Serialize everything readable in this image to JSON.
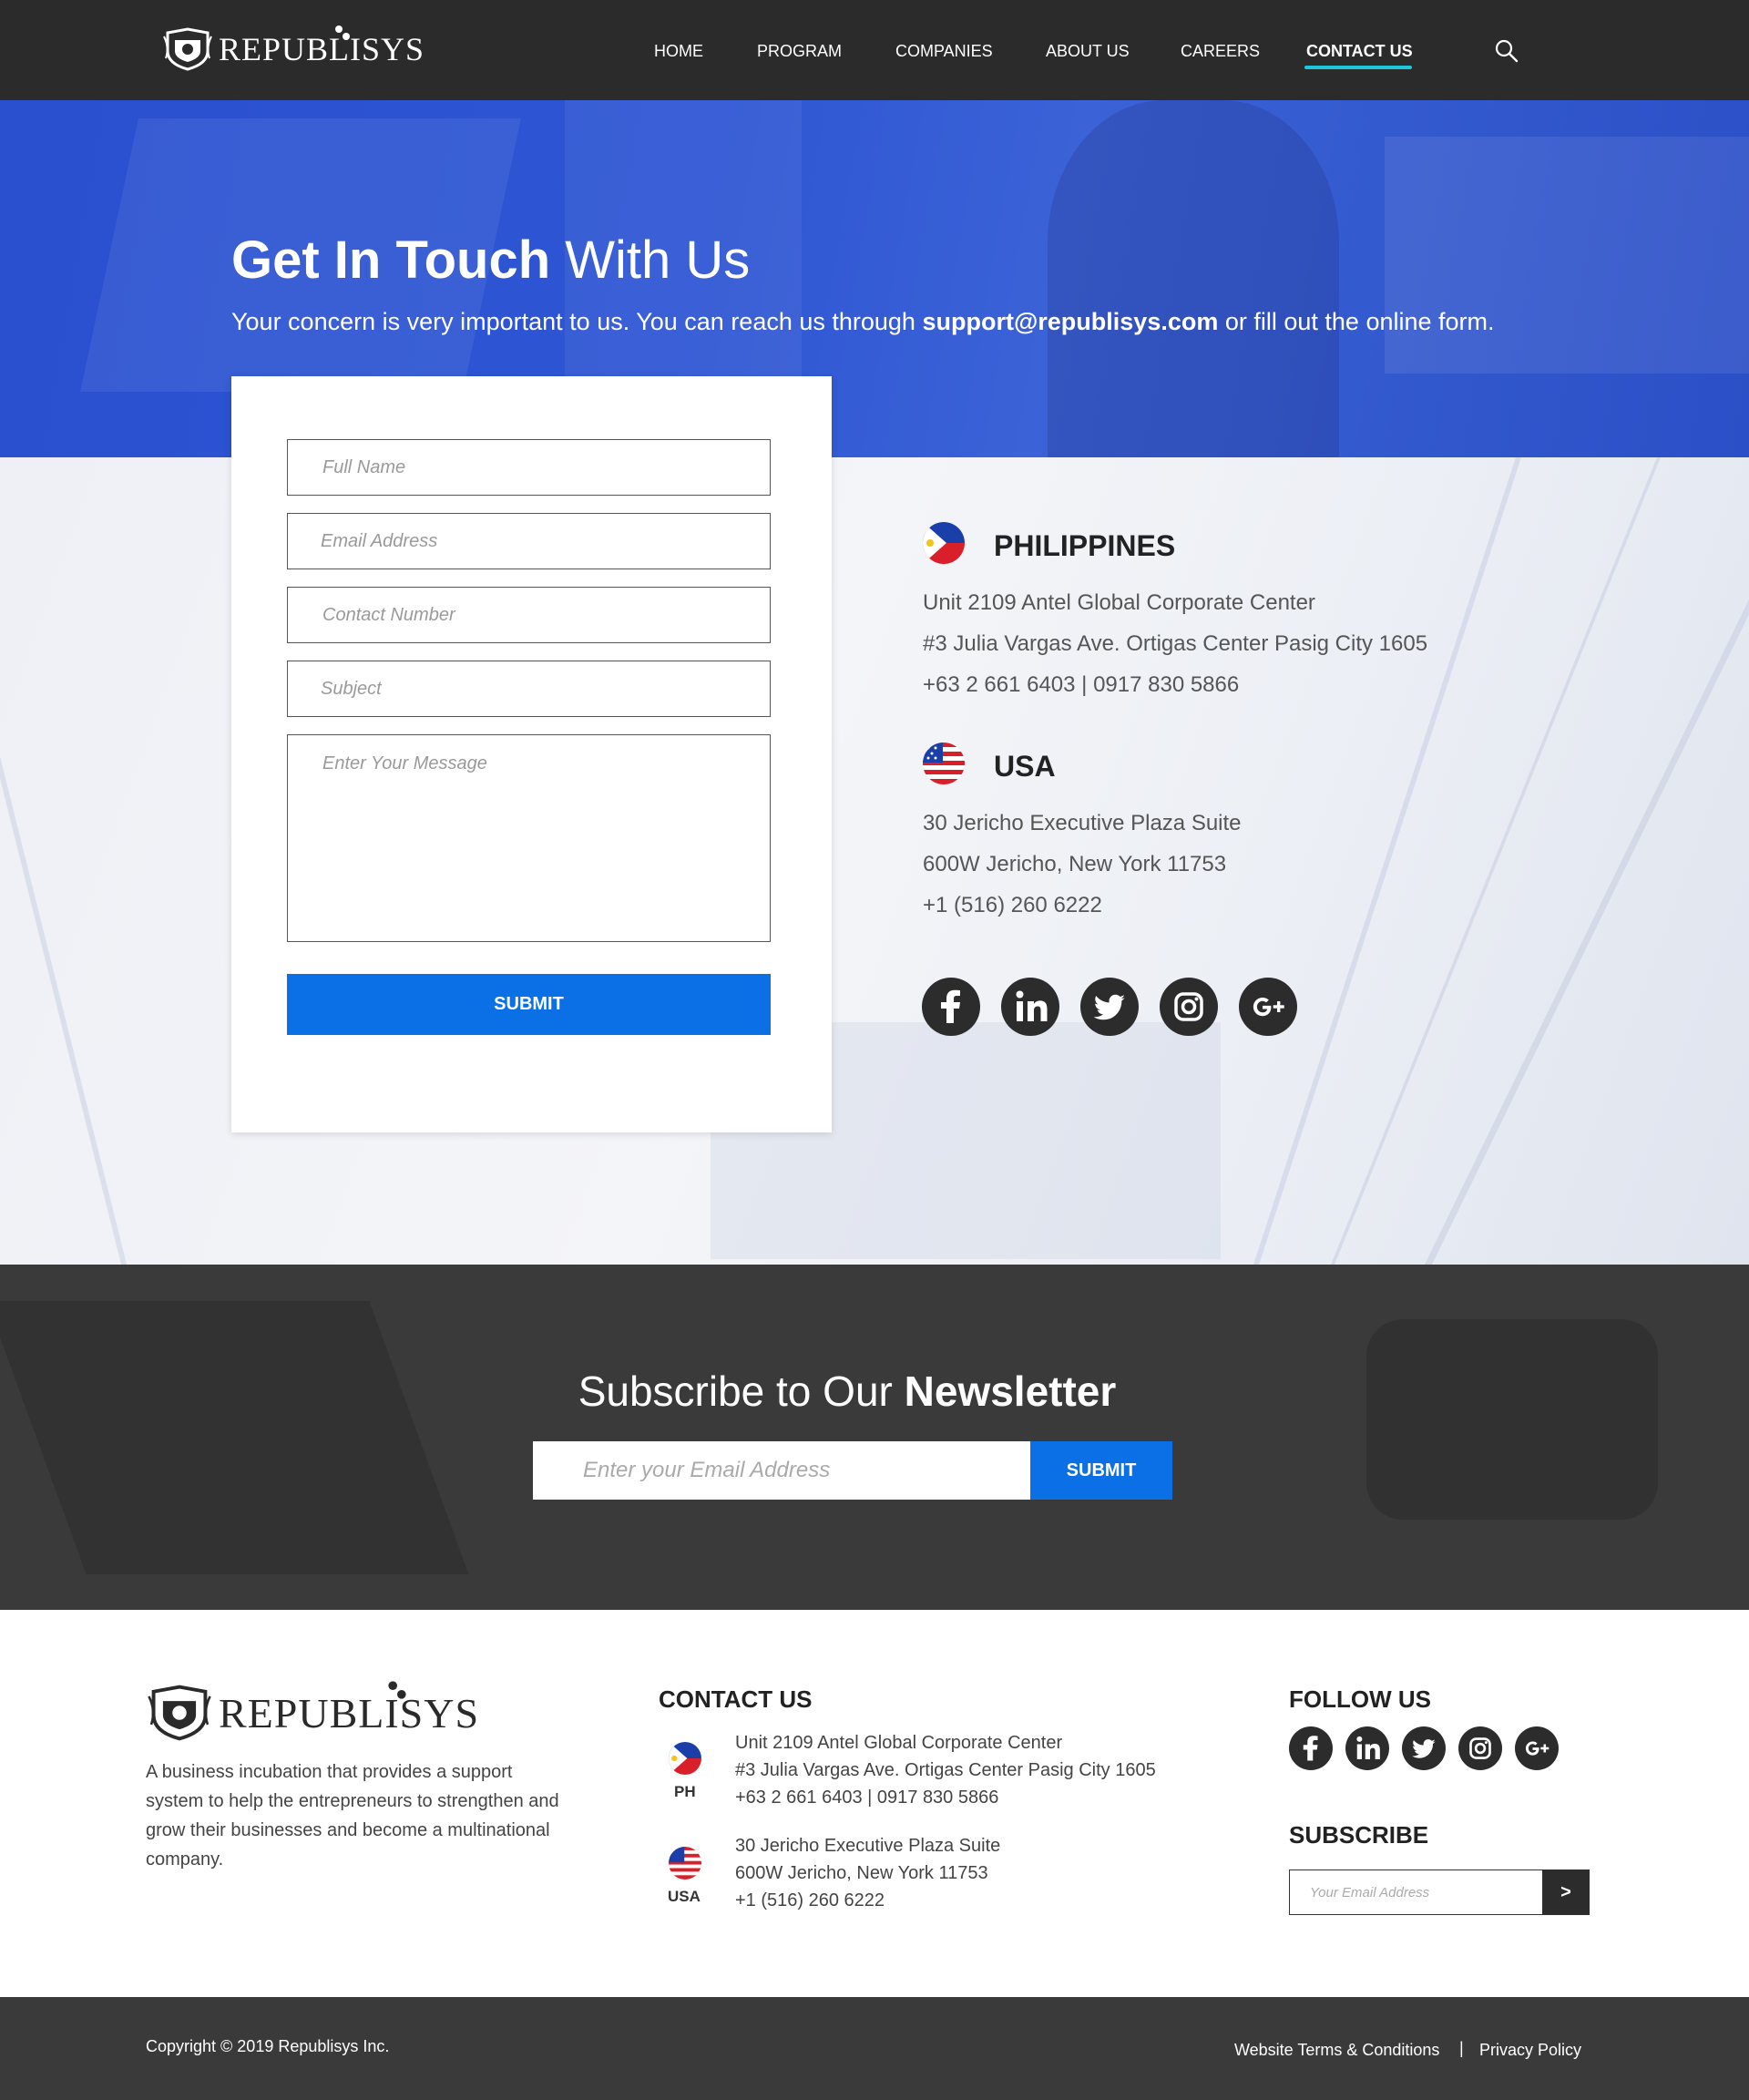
{
  "header": {
    "logo_text": "REPUBLISYS",
    "nav": [
      "HOME",
      "PROGRAM",
      "COMPANIES",
      "ABOUT US",
      "CAREERS",
      "CONTACT US"
    ],
    "active_nav": "CONTACT US",
    "search_icon": "search-icon",
    "accent_color": "#1ec6d9"
  },
  "hero": {
    "title_bold": "Get In Touch",
    "title_light": "With Us",
    "subtitle_before": "Your concern is very important to us. You can reach us through",
    "subtitle_email": "support@republisys.com",
    "subtitle_after": "or fill out the online form."
  },
  "form": {
    "full_name_placeholder": "Full Name",
    "email_placeholder": "Email Address",
    "contact_placeholder": "Contact Number",
    "subject_placeholder": "Subject",
    "message_placeholder": "Enter Your Message",
    "submit_label": "SUBMIT",
    "submit_color": "#0b6fe6"
  },
  "offices": [
    {
      "name": "PHILIPPINES",
      "flag": "philippines-flag-icon",
      "lines": [
        "Unit 2109 Antel Global Corporate Center",
        "#3 Julia Vargas Ave. Ortigas Center Pasig City 1605",
        "+63 2 661 6403 | 0917 830 5866"
      ]
    },
    {
      "name": "USA",
      "flag": "usa-flag-icon",
      "lines": [
        "30 Jericho Executive Plaza Suite",
        "600W Jericho, New York 11753",
        "+1 (516) 260 6222"
      ]
    }
  ],
  "social": [
    "facebook-icon",
    "linkedin-icon",
    "twitter-icon",
    "instagram-icon",
    "google-plus-icon"
  ],
  "newsletter": {
    "title_light": "Subscribe to Our",
    "title_bold": "Newsletter",
    "placeholder": "Enter your Email Address",
    "submit_label": "SUBMIT"
  },
  "footer": {
    "logo_text": "REPUBLISYS",
    "about": "A business incubation that provides a support system to help the entrepreneurs to strengthen and grow their businesses and become a multinational company.",
    "contact_heading": "CONTACT US",
    "ph_code": "PH",
    "ph_lines": [
      "Unit 2109 Antel Global Corporate Center",
      "#3 Julia Vargas Ave. Ortigas Center Pasig City 1605",
      "+63 2 661 6403 | 0917 830 5866"
    ],
    "usa_code": "USA",
    "usa_lines": [
      "30 Jericho Executive Plaza Suite",
      "600W Jericho, New York 11753",
      "+1 (516) 260 6222"
    ],
    "follow_heading": "FOLLOW US",
    "subscribe_heading": "SUBSCRIBE",
    "subscribe_placeholder": "Your Email Address",
    "subscribe_button": ">"
  },
  "bottom": {
    "copyright": "Copyright © 2019 Republisys Inc.",
    "terms": "Website Terms & Conditions",
    "separator": "|",
    "privacy": "Privacy Policy"
  }
}
